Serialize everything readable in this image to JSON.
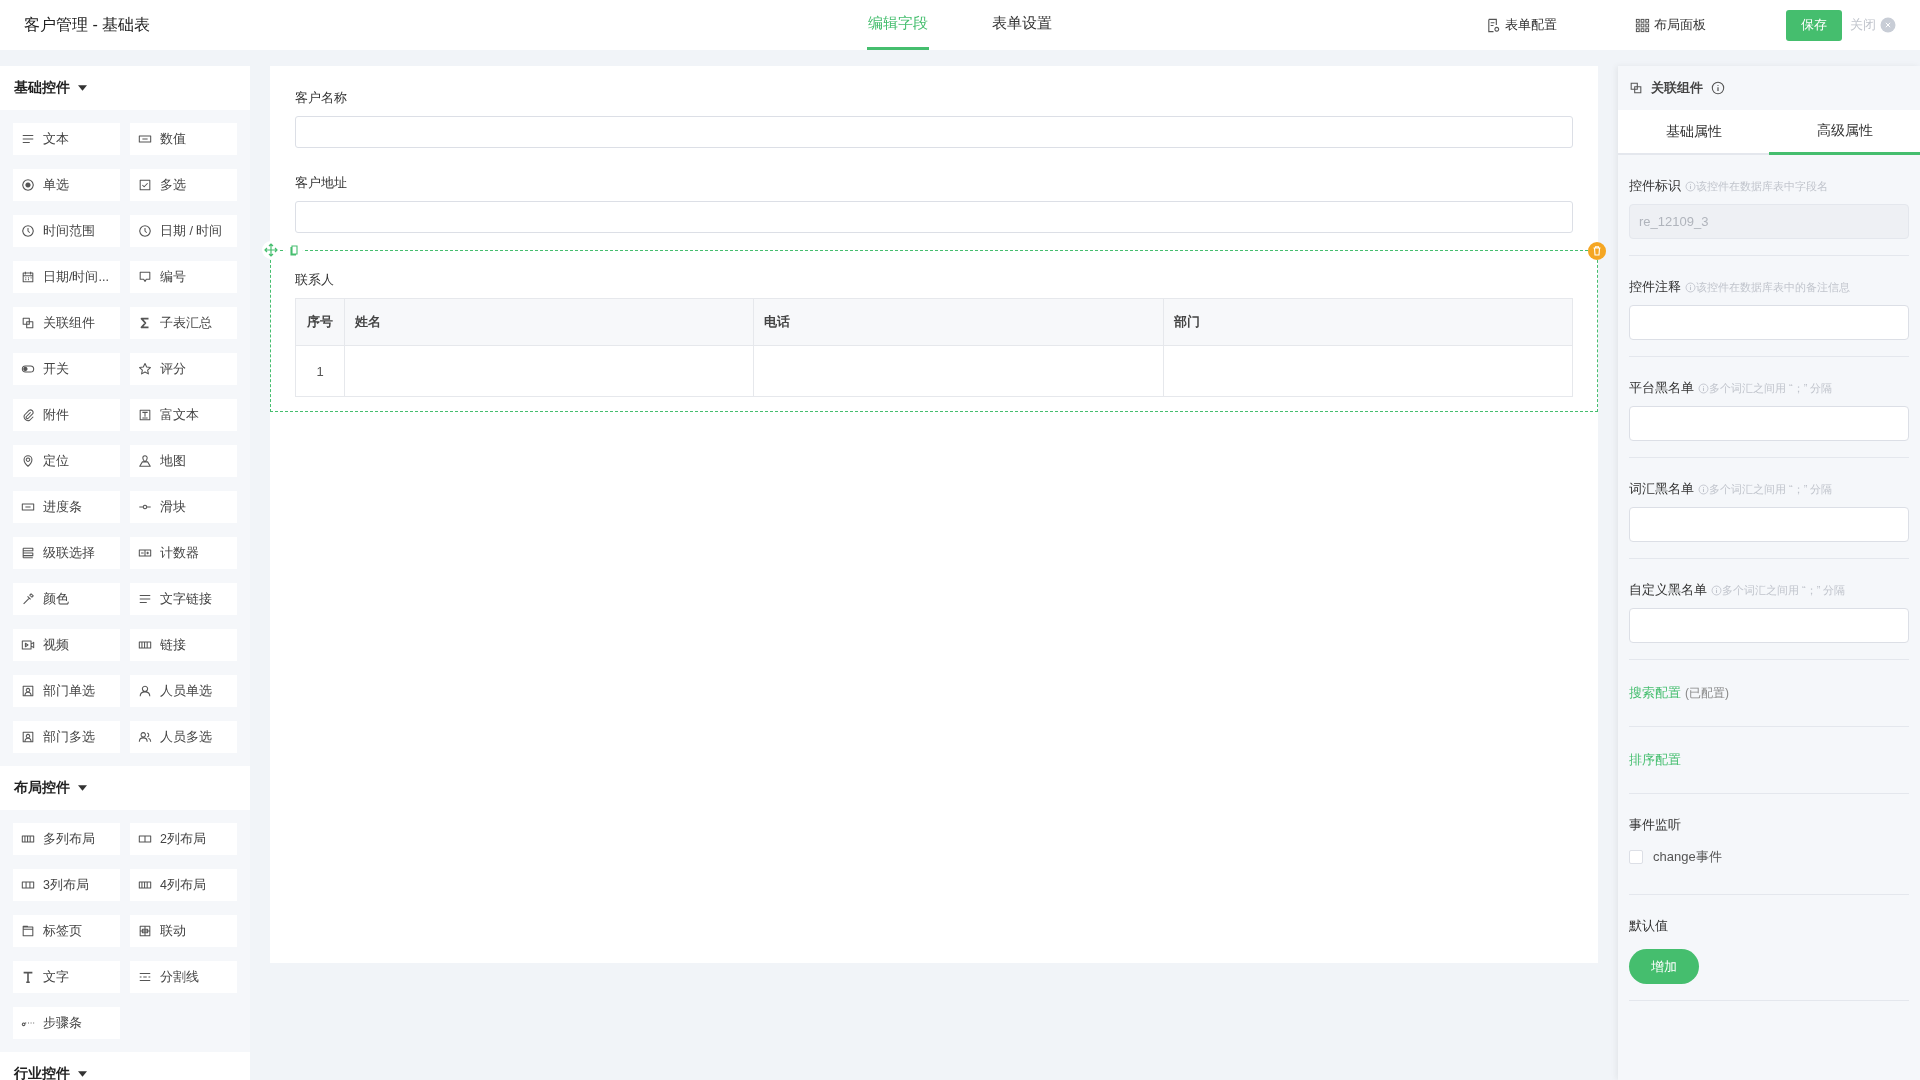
{
  "header": {
    "title": "客户管理 - 基础表",
    "tabs": [
      {
        "label": "编辑字段",
        "selected": true
      },
      {
        "label": "表单设置",
        "selected": false
      }
    ],
    "actions": [
      {
        "label": "表单配置"
      },
      {
        "label": "布局面板"
      }
    ],
    "save": "保存",
    "close": "关闭"
  },
  "sidebar": {
    "sections": [
      {
        "title": "基础控件",
        "items": [
          "文本",
          "数值",
          "单选",
          "多选",
          "时间范围",
          "日期 / 时间",
          "日期/时间...",
          "编号",
          "关联组件",
          "子表汇总",
          "开关",
          "评分",
          "附件",
          "富文本",
          "定位",
          "地图",
          "进度条",
          "滑块",
          "级联选择",
          "计数器",
          "颜色",
          "文字链接",
          "视频",
          "链接",
          "部门单选",
          "人员单选",
          "部门多选",
          "人员多选"
        ]
      },
      {
        "title": "布局控件",
        "items": [
          "多列布局",
          "2列布局",
          "3列布局",
          "4列布局",
          "标签页",
          "联动",
          "文字",
          "分割线",
          "步骤条"
        ]
      },
      {
        "title": "行业控件"
      }
    ]
  },
  "canvas": {
    "fields": [
      {
        "kind": "input",
        "label": "客户名称",
        "selected": false
      },
      {
        "kind": "input",
        "label": "客户地址",
        "selected": false
      },
      {
        "kind": "subtable",
        "label": "联系人",
        "selected": true,
        "columns": [
          "序号",
          "姓名",
          "电话",
          "部门"
        ],
        "rows": [
          {
            "no": "1"
          }
        ]
      }
    ]
  },
  "inspector": {
    "component": "关联组件",
    "tabs": [
      {
        "label": "基础属性",
        "selected": false
      },
      {
        "label": "高级属性",
        "selected": true
      }
    ],
    "fields": [
      {
        "label": "控件标识",
        "hint": "该控件在数据库表中字段名",
        "value": "re_12109_3",
        "disabled": true
      },
      {
        "label": "控件注释",
        "hint": "该控件在数据库表中的备注信息",
        "disabled": false
      },
      {
        "label": "平台黑名单",
        "hint": "多个词汇之间用 “；” 分隔",
        "disabled": false
      },
      {
        "label": "词汇黑名单",
        "hint": "多个词汇之间用 “；” 分隔",
        "disabled": false
      },
      {
        "label": "自定义黑名单",
        "hint": "多个词汇之间用 “；” 分隔",
        "disabled": false
      }
    ],
    "links": [
      {
        "label": "搜索配置",
        "note": "(已配置)"
      },
      {
        "label": "排序配置"
      }
    ],
    "events": {
      "title": "事件监听",
      "options": [
        {
          "label": "change事件",
          "checked": false
        }
      ]
    },
    "default_value": {
      "title": "默认值",
      "button": "增加"
    }
  }
}
